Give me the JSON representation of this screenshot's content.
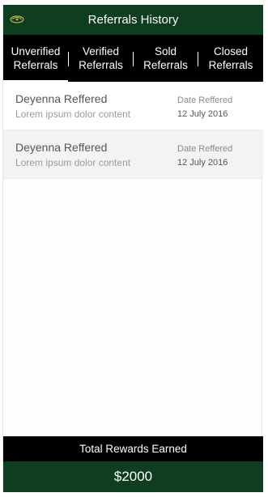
{
  "header": {
    "title": "Referrals History",
    "logo_icon": "leaf-logo-icon"
  },
  "tabs": [
    {
      "line1": "Unverified",
      "line2": "Referrals",
      "active": true
    },
    {
      "line1": "Verified",
      "line2": "Referrals",
      "active": false
    },
    {
      "line1": "Sold",
      "line2": "Referrals",
      "active": false
    },
    {
      "line1": "Closed",
      "line2": "Referrals",
      "active": false
    }
  ],
  "referrals": [
    {
      "name": "Deyenna Reffered",
      "description": "Lorem ipsum dolor content",
      "date_label": "Date Reffered",
      "date": "12 July 2016"
    },
    {
      "name": "Deyenna Reffered",
      "description": "Lorem ipsum dolor content",
      "date_label": "Date Reffered",
      "date": "12 July 2016"
    }
  ],
  "footer": {
    "label": "Total Rewards Earned",
    "amount": "$2000"
  },
  "colors": {
    "brand_green": "#0e3d1f",
    "tab_bar": "#000000",
    "row_alt": "#f3f3f3"
  }
}
